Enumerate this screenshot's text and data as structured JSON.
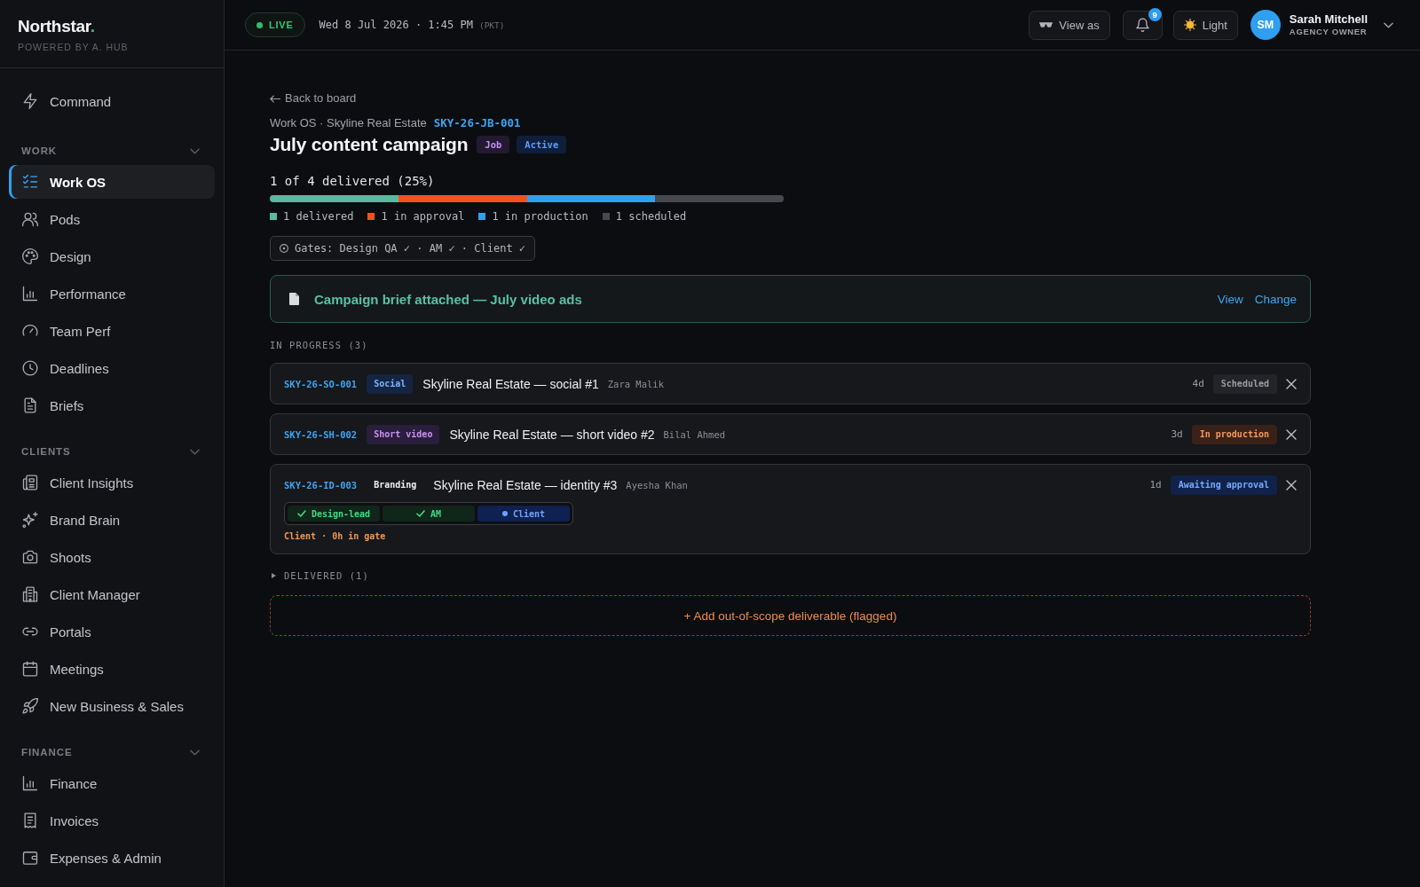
{
  "sidebar": {
    "brand": {
      "name": "Northstar",
      "accent": ".",
      "tagline": "POWERED BY A. HUB"
    },
    "top_items": [
      {
        "label": "Command",
        "selected": false
      }
    ],
    "sections": [
      {
        "title": "WORK",
        "expanded": true,
        "items": [
          {
            "label": "Work OS",
            "selected": true
          },
          {
            "label": "Pods",
            "selected": false
          },
          {
            "label": "Design",
            "selected": false
          },
          {
            "label": "Performance",
            "selected": false
          },
          {
            "label": "Team Perf",
            "selected": false
          },
          {
            "label": "Deadlines",
            "selected": false
          },
          {
            "label": "Briefs",
            "selected": false
          }
        ]
      },
      {
        "title": "CLIENTS",
        "expanded": true,
        "items": [
          {
            "label": "Client Insights",
            "selected": false
          },
          {
            "label": "Brand Brain",
            "selected": false
          },
          {
            "label": "Shoots",
            "selected": false
          },
          {
            "label": "Client Manager",
            "selected": false
          },
          {
            "label": "Portals",
            "selected": false
          },
          {
            "label": "Meetings",
            "selected": false
          },
          {
            "label": "New Business & Sales",
            "selected": false
          }
        ]
      },
      {
        "title": "FINANCE",
        "expanded": true,
        "items": [
          {
            "label": "Finance",
            "selected": false
          },
          {
            "label": "Invoices",
            "selected": false
          },
          {
            "label": "Expenses & Admin",
            "selected": false
          }
        ]
      }
    ]
  },
  "top_bar": {
    "live": "LIVE",
    "datetime": "Wed 8 Jul 2026 · 1:45 PM",
    "timezone": "(PKT)",
    "view_as": "View as",
    "notifications": "9",
    "theme": "Light",
    "user": {
      "initials": "SM",
      "name": "Sarah Mitchell",
      "role": "AGENCY OWNER"
    }
  },
  "job": {
    "back_link": "Back to board",
    "breadcrumb": "Work OS · Skyline Real Estate",
    "code": "SKY-26-JB-001",
    "title": "July content campaign",
    "badges": [
      {
        "label": "Job",
        "kind": "type"
      },
      {
        "label": "Active",
        "kind": "state"
      }
    ],
    "progress": {
      "summary": "1 of 4 delivered (25%)",
      "segments": [
        {
          "label": "1 delivered",
          "color": "#5ab9a0"
        },
        {
          "label": "1 in approval",
          "color": "#f4511e"
        },
        {
          "label": "1 in production",
          "color": "#2fa0f0"
        },
        {
          "label": "1 scheduled",
          "color": "#47494e"
        }
      ]
    },
    "gates_summary": "Gates: Design QA ✓ · AM ✓ · Client ✓",
    "brief": {
      "text": "Campaign brief attached — July video ads",
      "actions": [
        "View",
        "Change"
      ]
    },
    "in_progress": {
      "heading": "IN PROGRESS (3)",
      "rows": [
        {
          "code": "SKY-26-SO-001",
          "tag": {
            "label": "Social",
            "kind": "social"
          },
          "title": "Skyline Real Estate — social #1",
          "assignee": "Zara Malik",
          "age": "4d",
          "status": {
            "label": "Scheduled",
            "kind": "scheduled"
          }
        },
        {
          "code": "SKY-26-SH-002",
          "tag": {
            "label": "Short video",
            "kind": "video"
          },
          "title": "Skyline Real Estate — short video #2",
          "assignee": "Bilal Ahmed",
          "age": "3d",
          "status": {
            "label": "In production",
            "kind": "production"
          }
        },
        {
          "code": "SKY-26-ID-003",
          "tag": {
            "label": "Branding",
            "kind": "branding"
          },
          "title": "Skyline Real Estate — identity #3",
          "assignee": "Ayesha Khan",
          "age": "1d",
          "status": {
            "label": "Awaiting approval",
            "kind": "approval"
          },
          "gates": [
            {
              "label": "Design-lead",
              "passed": true
            },
            {
              "label": "AM",
              "passed": true
            },
            {
              "label": "Client",
              "passed": false
            }
          ],
          "gate_note": "Client · 0h in gate"
        }
      ]
    },
    "delivered": {
      "heading": "DELIVERED (1)",
      "expanded": false
    },
    "add_button": "+ Add out-of-scope deliverable (flagged)"
  }
}
